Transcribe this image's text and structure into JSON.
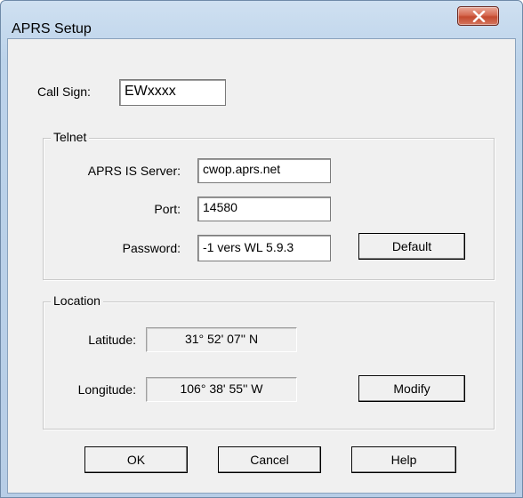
{
  "window": {
    "title": "APRS Setup"
  },
  "callsign": {
    "label": "Call Sign:",
    "value": "EWxxxx"
  },
  "telnet": {
    "group_label": "Telnet",
    "server_label": "APRS IS Server:",
    "server_value": "cwop.aprs.net",
    "port_label": "Port:",
    "port_value": "14580",
    "password_label": "Password:",
    "password_value": "-1 vers WL 5.9.3",
    "default_button": "Default"
  },
  "location": {
    "group_label": "Location",
    "latitude_label": "Latitude:",
    "latitude_value": "31° 52' 07'' N",
    "longitude_label": "Longitude:",
    "longitude_value": "106° 38' 55'' W",
    "modify_button": "Modify"
  },
  "buttons": {
    "ok": "OK",
    "cancel": "Cancel",
    "help": "Help"
  },
  "icons": {
    "close": "close-icon"
  }
}
